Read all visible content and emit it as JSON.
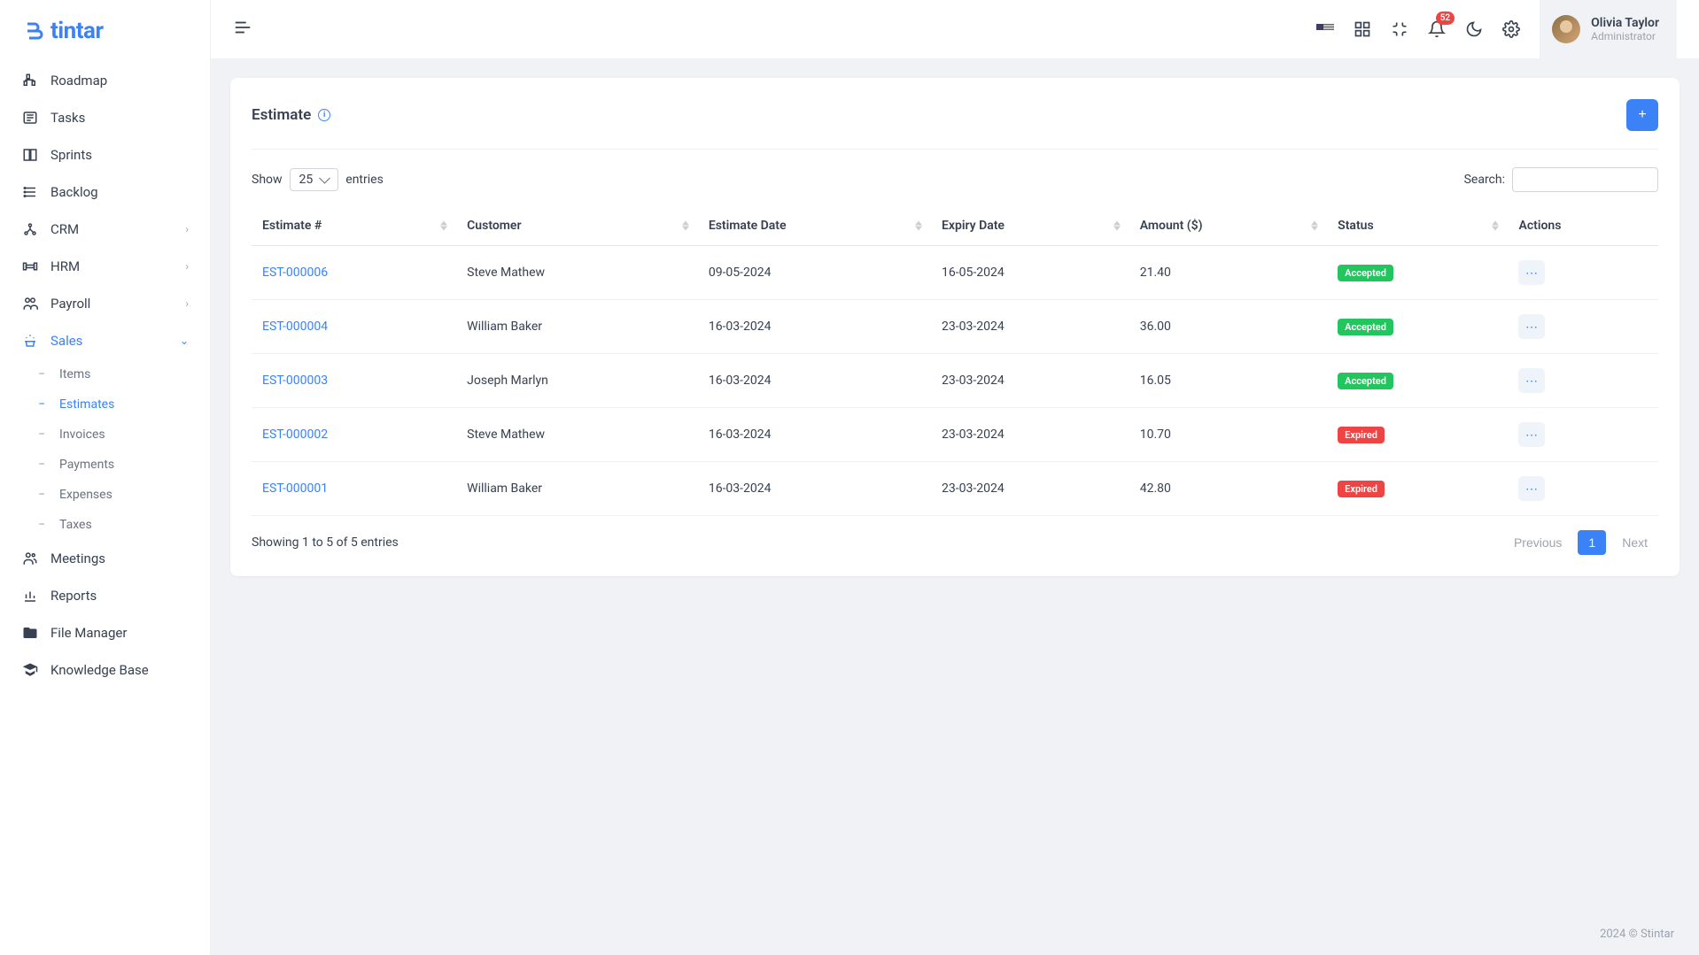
{
  "logo": "tintar",
  "sidebar": {
    "items": [
      {
        "label": "Roadmap",
        "icon": "roadmap"
      },
      {
        "label": "Tasks",
        "icon": "tasks"
      },
      {
        "label": "Sprints",
        "icon": "sprints"
      },
      {
        "label": "Backlog",
        "icon": "backlog"
      },
      {
        "label": "CRM",
        "icon": "crm",
        "expandable": true
      },
      {
        "label": "HRM",
        "icon": "hrm",
        "expandable": true
      },
      {
        "label": "Payroll",
        "icon": "payroll",
        "expandable": true
      },
      {
        "label": "Sales",
        "icon": "sales",
        "expandable": true,
        "active": true
      },
      {
        "label": "Meetings",
        "icon": "meetings"
      },
      {
        "label": "Reports",
        "icon": "reports"
      },
      {
        "label": "File Manager",
        "icon": "files"
      },
      {
        "label": "Knowledge Base",
        "icon": "knowledge"
      }
    ],
    "subitems": [
      {
        "label": "Items"
      },
      {
        "label": "Estimates",
        "active": true
      },
      {
        "label": "Invoices"
      },
      {
        "label": "Payments"
      },
      {
        "label": "Expenses"
      },
      {
        "label": "Taxes"
      }
    ]
  },
  "header": {
    "notif_count": "52",
    "user_name": "Olivia Taylor",
    "user_role": "Administrator"
  },
  "page": {
    "title": "Estimate",
    "show_label": "Show",
    "entries_label": "entries",
    "entries_value": "25",
    "search_label": "Search:",
    "columns": [
      "Estimate #",
      "Customer",
      "Estimate Date",
      "Expiry Date",
      "Amount ($)",
      "Status",
      "Actions"
    ],
    "rows": [
      {
        "id": "EST-000006",
        "customer": "Steve Mathew",
        "date": "09-05-2024",
        "expiry": "16-05-2024",
        "amount": "21.40",
        "status": "Accepted",
        "status_class": "accepted"
      },
      {
        "id": "EST-000004",
        "customer": "William Baker",
        "date": "16-03-2024",
        "expiry": "23-03-2024",
        "amount": "36.00",
        "status": "Accepted",
        "status_class": "accepted"
      },
      {
        "id": "EST-000003",
        "customer": "Joseph Marlyn",
        "date": "16-03-2024",
        "expiry": "23-03-2024",
        "amount": "16.05",
        "status": "Accepted",
        "status_class": "accepted"
      },
      {
        "id": "EST-000002",
        "customer": "Steve Mathew",
        "date": "16-03-2024",
        "expiry": "23-03-2024",
        "amount": "10.70",
        "status": "Expired",
        "status_class": "expired"
      },
      {
        "id": "EST-000001",
        "customer": "William Baker",
        "date": "16-03-2024",
        "expiry": "23-03-2024",
        "amount": "42.80",
        "status": "Expired",
        "status_class": "expired"
      }
    ],
    "showing_text": "Showing 1 to 5 of 5 entries",
    "prev_label": "Previous",
    "next_label": "Next",
    "page_num": "1"
  },
  "footer": "2024 © Stintar"
}
